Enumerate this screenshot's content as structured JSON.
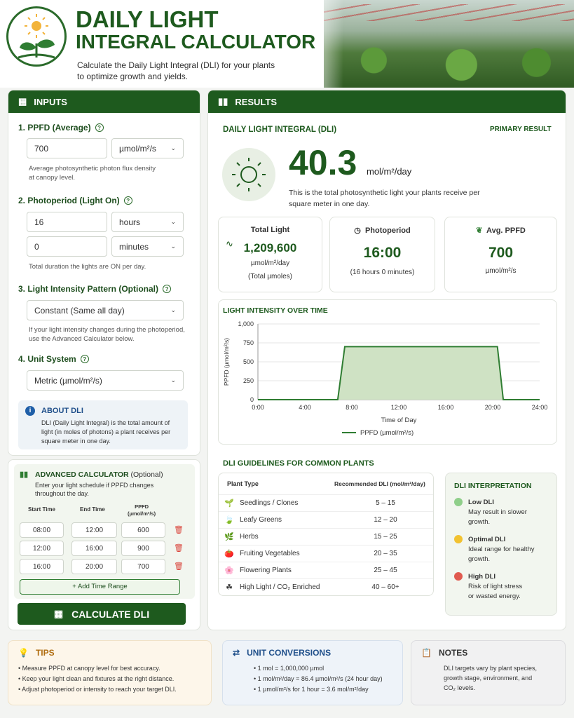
{
  "header": {
    "title_line1": "DAILY LIGHT",
    "title_line2": "INTEGRAL CALCULATOR",
    "subtitle_line1": "Calculate the Daily Light Integral (DLI) for your plants",
    "subtitle_line2": "to optimize growth and yields."
  },
  "inputs": {
    "title": "INPUTS",
    "ppfd": {
      "label": "1.  PPFD (Average)",
      "value": "700",
      "unit": "µmol/m²/s",
      "help1": "Average photosynthetic photon flux density",
      "help2": "at canopy level."
    },
    "photoperiod": {
      "label": "2.  Photoperiod (Light On)",
      "hours_value": "16",
      "hours_unit": "hours",
      "minutes_value": "0",
      "minutes_unit": "minutes",
      "help": "Total duration the lights are ON per day."
    },
    "pattern": {
      "label": "3.  Light Intensity Pattern (Optional)",
      "value": "Constant (Same all day)",
      "help1": "If your light intensity changes during the photoperiod,",
      "help2": "use the Advanced Calculator below."
    },
    "units": {
      "label": "4.  Unit System",
      "value": "Metric (µmol/m²/s)"
    },
    "about": {
      "title": "ABOUT DLI",
      "text1": "DLI (Daily Light Integral) is the total amount of",
      "text2": "light (in moles of photons) a plant receives per",
      "text3": "square meter in one day."
    }
  },
  "advanced": {
    "title": "ADVANCED CALCULATOR",
    "optional": "(Optional)",
    "desc1": "Enter your light schedule if PPFD changes",
    "desc2": "throughout the day.",
    "col_start": "Start Time",
    "col_end": "End Time",
    "col_ppfd1": "PPFD",
    "col_ppfd2": "(µmol/m²/s)",
    "rows": [
      {
        "start": "08:00",
        "end": "12:00",
        "ppfd": "600"
      },
      {
        "start": "12:00",
        "end": "16:00",
        "ppfd": "900"
      },
      {
        "start": "16:00",
        "end": "20:00",
        "ppfd": "700"
      }
    ],
    "add_label": "+ Add Time Range",
    "calc_label": "CALCULATE DLI"
  },
  "results": {
    "title": "RESULTS",
    "dli_label": "DAILY LIGHT INTEGRAL (DLI)",
    "primary": "PRIMARY RESULT",
    "dli_value": "40.3",
    "dli_unit": "mol/m²/day",
    "dli_desc1": "This is the total photosynthetic light your plants receive per",
    "dli_desc2": "square meter in one day.",
    "total": {
      "label": "Total Light",
      "value": "1,209,600",
      "unit": "µmol/m²/day",
      "note": "(Total µmoles)"
    },
    "photo": {
      "label": "Photoperiod",
      "value": "16:00",
      "note": "(16 hours 0 minutes)"
    },
    "avg": {
      "label": "Avg. PPFD",
      "value": "700",
      "unit": "µmol/m²/s"
    }
  },
  "chart_data": {
    "type": "area",
    "title": "LIGHT INTENSITY OVER TIME",
    "xlabel": "Time of Day",
    "ylabel": "PPFD (µmol/m²/s)",
    "xlim": [
      0,
      24
    ],
    "ylim": [
      0,
      1000
    ],
    "x_ticks": [
      "0:00",
      "4:00",
      "8:00",
      "12:00",
      "16:00",
      "20:00",
      "24:00"
    ],
    "y_ticks": [
      "0",
      "250",
      "500",
      "750",
      "1,000"
    ],
    "series": [
      {
        "name": "PPFD (µmol/m²/s)",
        "x": [
          0,
          6.8,
          7.4,
          20.4,
          20.9,
          24
        ],
        "y": [
          0,
          0,
          700,
          700,
          0,
          0
        ]
      }
    ],
    "legend": "bottom",
    "color": "#2f7d32"
  },
  "guidelines": {
    "title": "DLI GUIDELINES FOR COMMON PLANTS",
    "col_type": "Plant Type",
    "col_dli": "Recommended DLI (mol/m²/day)",
    "rows": [
      {
        "icon": "seedling-icon",
        "glyph": "🌱",
        "name": "Seedlings / Clones",
        "range": "5 – 15"
      },
      {
        "icon": "leaf-icon",
        "glyph": "🍃",
        "name": "Leafy Greens",
        "range": "12 – 20"
      },
      {
        "icon": "herb-icon",
        "glyph": "🌿",
        "name": "Herbs",
        "range": "15 – 25"
      },
      {
        "icon": "tomato-icon",
        "glyph": "🍅",
        "name": "Fruiting Vegetables",
        "range": "20 – 35"
      },
      {
        "icon": "flower-icon",
        "glyph": "🌸",
        "name": "Flowering Plants",
        "range": "25 – 45"
      },
      {
        "icon": "clover-icon",
        "glyph": "☘",
        "name": "High Light / CO₂ Enriched",
        "range": "40 – 60+"
      }
    ]
  },
  "interpretation": {
    "title": "DLI INTERPRETATION",
    "low": {
      "label": "Low DLI",
      "text1": "May result in slower",
      "text2": "growth.",
      "color": "#8fcf8a"
    },
    "optimal": {
      "label": "Optimal DLI",
      "text1": "Ideal range for healthy",
      "text2": "growth.",
      "color": "#f2c230"
    },
    "high": {
      "label": "High DLI",
      "text1": "Risk of light stress",
      "text2": "or wasted energy.",
      "color": "#e05a4f"
    }
  },
  "tips": {
    "title": "TIPS",
    "items": [
      "Measure PPFD at canopy level for best accuracy.",
      "Keep your light clean and fixtures at the right distance.",
      "Adjust photoperiod or intensity to reach your target DLI."
    ]
  },
  "conversions": {
    "title": "UNIT CONVERSIONS",
    "items": [
      "1 mol = 1,000,000 µmol",
      "1 mol/m²/day = 86.4 µmol/m²/s (24 hour day)",
      "1 µmol/m²/s for 1 hour = 3.6 mol/m²/day"
    ]
  },
  "notes": {
    "title": "NOTES",
    "text1": "DLI targets vary by plant species,",
    "text2": "growth stage, environment, and",
    "text3": "CO₂ levels."
  }
}
